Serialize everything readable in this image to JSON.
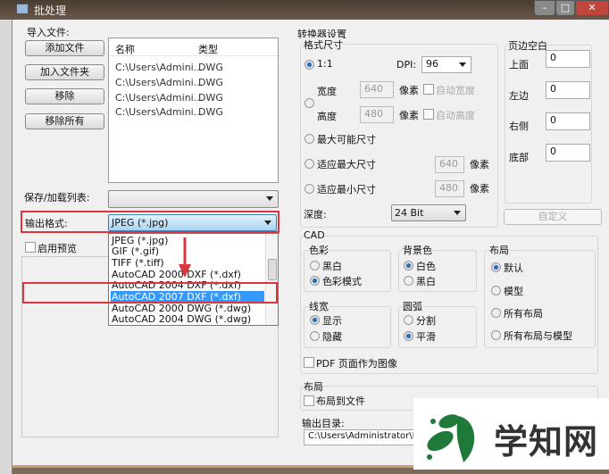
{
  "window": {
    "title": "批处理"
  },
  "import": {
    "label": "导入文件:",
    "buttons": [
      "添加文件",
      "加入文件夹",
      "移除",
      "移除所有"
    ],
    "columns": [
      "名称",
      "类型"
    ],
    "rows": [
      [
        "C:\\Users\\Admini...",
        "DWG"
      ],
      [
        "C:\\Users\\Admini...",
        "DWG"
      ],
      [
        "C:\\Users\\Admini...",
        "DWG"
      ],
      [
        "C:\\Users\\Admini...",
        "DWG"
      ]
    ]
  },
  "save_list": {
    "label": "保存/加载列表:",
    "value": ""
  },
  "output_format": {
    "label": "输出格式:",
    "value": "JPEG (*.jpg)",
    "options": [
      "JPEG (*.jpg)",
      "GIF (*.gif)",
      "TIFF (*.tiff)",
      "AutoCAD 2000 DXF (*.dxf)",
      "AutoCAD 2004 DXF (*.dxf)",
      "AutoCAD 2007 DXF (*.dxf)",
      "AutoCAD 2000 DWG (*.dwg)",
      "AutoCAD 2004 DWG (*.dwg)"
    ],
    "highlighted": "AutoCAD 2007 DXF (*.dxf)"
  },
  "preview": {
    "label": "启用预览",
    "checked": false
  },
  "converter": {
    "title": "转换器设置",
    "format_size": {
      "title": "格式尺寸",
      "ratio": "1:1",
      "dpi_label": "DPI:",
      "dpi": "96",
      "width_label": "宽度",
      "width": "640",
      "height_label": "高度",
      "height": "480",
      "pixel": "像素",
      "auto_width": "自动宽度",
      "auto_height": "自动高度",
      "max_possible": "最大可能尺寸",
      "fit_max": "适应最大尺寸",
      "fit_max_val": "640",
      "fit_min": "适应最小尺寸",
      "fit_min_val": "480",
      "depth_label": "深度:",
      "depth": "24 Bit"
    },
    "margins": {
      "title": "页边空白",
      "top_label": "上面",
      "top": "0",
      "left_label": "左边",
      "left": "0",
      "right_label": "右侧",
      "right": "0",
      "bottom_label": "底部",
      "bottom": "0",
      "custom": "自定义"
    }
  },
  "cad": {
    "title": "CAD",
    "color": {
      "title": "色彩",
      "options": [
        "黑白",
        "色彩模式"
      ],
      "selected": 1
    },
    "background": {
      "title": "背景色",
      "options": [
        "白色",
        "黑白"
      ],
      "selected": 0
    },
    "layout": {
      "title": "布局",
      "options": [
        "默认",
        "模型",
        "所有布局",
        "所有布局与模型"
      ],
      "selected": 0
    },
    "lineweight": {
      "title": "线宽",
      "options": [
        "显示",
        "隐藏"
      ],
      "selected": 0
    },
    "arc": {
      "title": "圆弧",
      "options": [
        "分割",
        "平滑"
      ],
      "selected": 1
    },
    "pdf_as_image": "PDF 页面作为图像"
  },
  "layout_section": {
    "title": "布局",
    "layout_to_file": "布局到文件"
  },
  "output_dir": {
    "label": "输出目录:",
    "value": "C:\\Users\\Administrator\\D..."
  },
  "watermark": {
    "text": "学知网"
  }
}
